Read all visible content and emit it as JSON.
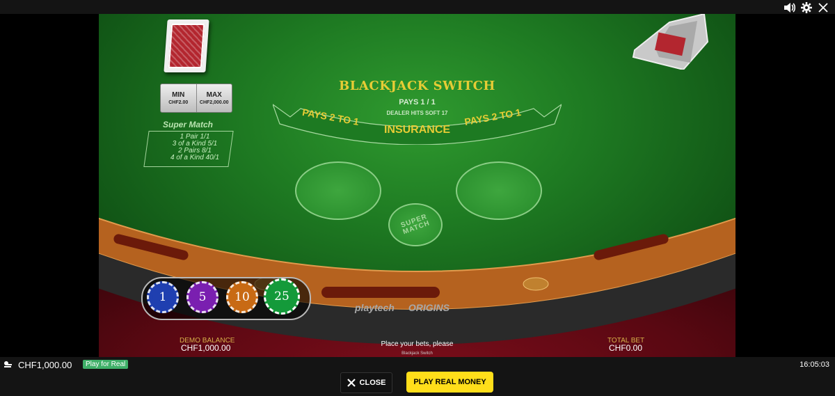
{
  "top_controls": {
    "sound_icon": "speaker-icon",
    "settings_icon": "gear-icon",
    "close_icon": "close-icon"
  },
  "table": {
    "title": "BLACKJACK SWITCH",
    "pays": "PAYS 1 / 1",
    "dealer_rule": "DEALER HITS SOFT 17",
    "insurance": "INSURANCE",
    "pays_2_to_1_left": "PAYS 2 TO 1",
    "pays_2_to_1_right": "PAYS 2 TO 1",
    "super_match_spot": "SUPER MATCH",
    "limits": {
      "min_label": "MIN",
      "min_value": "CHF2.00",
      "max_label": "MAX",
      "max_value": "CHF2,000.00"
    },
    "super_match": {
      "title": "Super Match",
      "lines": [
        "1 Pair 1/1",
        "3 of a Kind 5/1",
        "2 Pairs 8/1",
        "4 of a Kind 40/1"
      ]
    }
  },
  "chips": [
    {
      "value": "1",
      "color": "#1f3fb0"
    },
    {
      "value": "5",
      "color": "#7a1fb0"
    },
    {
      "value": "10",
      "color": "#c86a14"
    },
    {
      "value": "25",
      "color": "#149a3a"
    }
  ],
  "logos": {
    "left": "playtech",
    "right": "ORIGINS"
  },
  "status": {
    "demo_balance_label": "DEMO BALANCE",
    "demo_balance_value": "CHF1,000.00",
    "message": "Place your bets, please",
    "game_name": "Blackjack Switch",
    "total_bet_label": "TOTAL BET",
    "total_bet_value": "CHF0.00"
  },
  "footer": {
    "balance": "CHF1,000.00",
    "play_for_real": "Play for Real",
    "time": "16:05:03",
    "close_label": "CLOSE",
    "play_real_money_label": "PLAY REAL MONEY"
  }
}
